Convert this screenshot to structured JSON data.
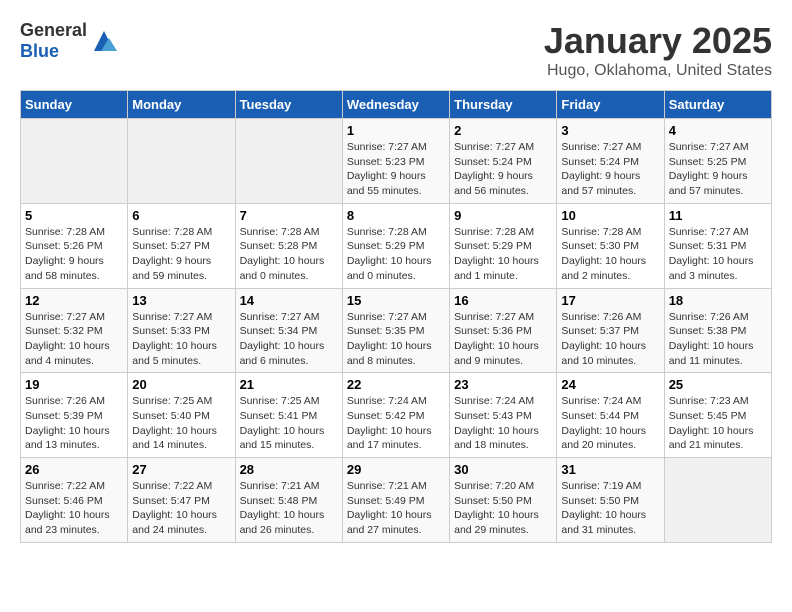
{
  "header": {
    "logo_general": "General",
    "logo_blue": "Blue",
    "title": "January 2025",
    "subtitle": "Hugo, Oklahoma, United States"
  },
  "days_of_week": [
    "Sunday",
    "Monday",
    "Tuesday",
    "Wednesday",
    "Thursday",
    "Friday",
    "Saturday"
  ],
  "weeks": [
    [
      {
        "day": "",
        "detail": ""
      },
      {
        "day": "",
        "detail": ""
      },
      {
        "day": "",
        "detail": ""
      },
      {
        "day": "1",
        "detail": "Sunrise: 7:27 AM\nSunset: 5:23 PM\nDaylight: 9 hours\nand 55 minutes."
      },
      {
        "day": "2",
        "detail": "Sunrise: 7:27 AM\nSunset: 5:24 PM\nDaylight: 9 hours\nand 56 minutes."
      },
      {
        "day": "3",
        "detail": "Sunrise: 7:27 AM\nSunset: 5:24 PM\nDaylight: 9 hours\nand 57 minutes."
      },
      {
        "day": "4",
        "detail": "Sunrise: 7:27 AM\nSunset: 5:25 PM\nDaylight: 9 hours\nand 57 minutes."
      }
    ],
    [
      {
        "day": "5",
        "detail": "Sunrise: 7:28 AM\nSunset: 5:26 PM\nDaylight: 9 hours\nand 58 minutes."
      },
      {
        "day": "6",
        "detail": "Sunrise: 7:28 AM\nSunset: 5:27 PM\nDaylight: 9 hours\nand 59 minutes."
      },
      {
        "day": "7",
        "detail": "Sunrise: 7:28 AM\nSunset: 5:28 PM\nDaylight: 10 hours\nand 0 minutes."
      },
      {
        "day": "8",
        "detail": "Sunrise: 7:28 AM\nSunset: 5:29 PM\nDaylight: 10 hours\nand 0 minutes."
      },
      {
        "day": "9",
        "detail": "Sunrise: 7:28 AM\nSunset: 5:29 PM\nDaylight: 10 hours\nand 1 minute."
      },
      {
        "day": "10",
        "detail": "Sunrise: 7:28 AM\nSunset: 5:30 PM\nDaylight: 10 hours\nand 2 minutes."
      },
      {
        "day": "11",
        "detail": "Sunrise: 7:27 AM\nSunset: 5:31 PM\nDaylight: 10 hours\nand 3 minutes."
      }
    ],
    [
      {
        "day": "12",
        "detail": "Sunrise: 7:27 AM\nSunset: 5:32 PM\nDaylight: 10 hours\nand 4 minutes."
      },
      {
        "day": "13",
        "detail": "Sunrise: 7:27 AM\nSunset: 5:33 PM\nDaylight: 10 hours\nand 5 minutes."
      },
      {
        "day": "14",
        "detail": "Sunrise: 7:27 AM\nSunset: 5:34 PM\nDaylight: 10 hours\nand 6 minutes."
      },
      {
        "day": "15",
        "detail": "Sunrise: 7:27 AM\nSunset: 5:35 PM\nDaylight: 10 hours\nand 8 minutes."
      },
      {
        "day": "16",
        "detail": "Sunrise: 7:27 AM\nSunset: 5:36 PM\nDaylight: 10 hours\nand 9 minutes."
      },
      {
        "day": "17",
        "detail": "Sunrise: 7:26 AM\nSunset: 5:37 PM\nDaylight: 10 hours\nand 10 minutes."
      },
      {
        "day": "18",
        "detail": "Sunrise: 7:26 AM\nSunset: 5:38 PM\nDaylight: 10 hours\nand 11 minutes."
      }
    ],
    [
      {
        "day": "19",
        "detail": "Sunrise: 7:26 AM\nSunset: 5:39 PM\nDaylight: 10 hours\nand 13 minutes."
      },
      {
        "day": "20",
        "detail": "Sunrise: 7:25 AM\nSunset: 5:40 PM\nDaylight: 10 hours\nand 14 minutes."
      },
      {
        "day": "21",
        "detail": "Sunrise: 7:25 AM\nSunset: 5:41 PM\nDaylight: 10 hours\nand 15 minutes."
      },
      {
        "day": "22",
        "detail": "Sunrise: 7:24 AM\nSunset: 5:42 PM\nDaylight: 10 hours\nand 17 minutes."
      },
      {
        "day": "23",
        "detail": "Sunrise: 7:24 AM\nSunset: 5:43 PM\nDaylight: 10 hours\nand 18 minutes."
      },
      {
        "day": "24",
        "detail": "Sunrise: 7:24 AM\nSunset: 5:44 PM\nDaylight: 10 hours\nand 20 minutes."
      },
      {
        "day": "25",
        "detail": "Sunrise: 7:23 AM\nSunset: 5:45 PM\nDaylight: 10 hours\nand 21 minutes."
      }
    ],
    [
      {
        "day": "26",
        "detail": "Sunrise: 7:22 AM\nSunset: 5:46 PM\nDaylight: 10 hours\nand 23 minutes."
      },
      {
        "day": "27",
        "detail": "Sunrise: 7:22 AM\nSunset: 5:47 PM\nDaylight: 10 hours\nand 24 minutes."
      },
      {
        "day": "28",
        "detail": "Sunrise: 7:21 AM\nSunset: 5:48 PM\nDaylight: 10 hours\nand 26 minutes."
      },
      {
        "day": "29",
        "detail": "Sunrise: 7:21 AM\nSunset: 5:49 PM\nDaylight: 10 hours\nand 27 minutes."
      },
      {
        "day": "30",
        "detail": "Sunrise: 7:20 AM\nSunset: 5:50 PM\nDaylight: 10 hours\nand 29 minutes."
      },
      {
        "day": "31",
        "detail": "Sunrise: 7:19 AM\nSunset: 5:50 PM\nDaylight: 10 hours\nand 31 minutes."
      },
      {
        "day": "",
        "detail": ""
      }
    ]
  ]
}
